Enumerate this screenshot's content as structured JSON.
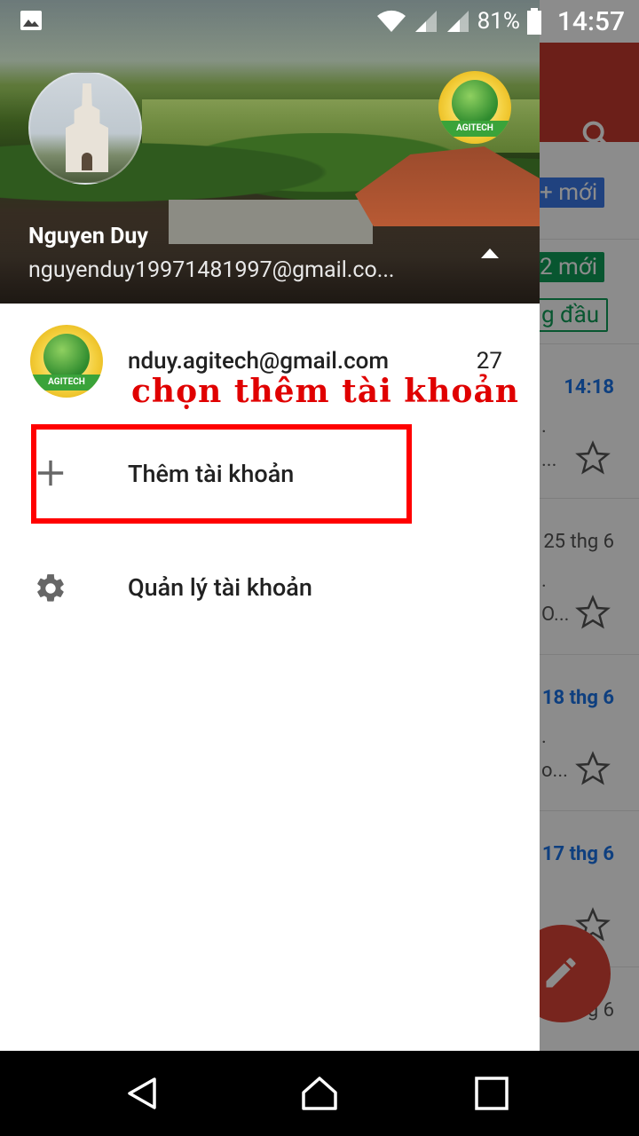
{
  "status_bar": {
    "notification_icon": "image-icon",
    "battery_percent": "81%",
    "time": "14:57"
  },
  "background": {
    "chips": [
      "+ mới",
      "2 mới",
      "g đầu"
    ],
    "rows": [
      {
        "time": "14:18",
        "bold": true
      },
      {
        "time": "25 thg 6",
        "bold": false
      },
      {
        "time": "18 thg 6",
        "bold": true
      },
      {
        "time": "17 thg 6",
        "bold": true
      },
      {
        "time": "g 6",
        "bold": false
      }
    ],
    "snippets": [
      "...",
      "O...",
      "o..."
    ]
  },
  "drawer": {
    "header": {
      "name": "Nguyen Duy",
      "email": "nguyenduy19971481997@gmail.co...",
      "logo_text": "AGITECH"
    },
    "accounts": [
      {
        "email": "nduy.agitech@gmail.com",
        "count": "27",
        "logo_text": "AGITECH"
      }
    ],
    "annotation": "chọn thêm tài khoản",
    "menu": {
      "add_account": "Thêm tài khoản",
      "manage_accounts": "Quản lý tài khoản"
    }
  },
  "colors": {
    "toolbar": "#c5392f",
    "fab": "#db4437",
    "highlight": "#ff0000",
    "annotation": "#e00000"
  }
}
